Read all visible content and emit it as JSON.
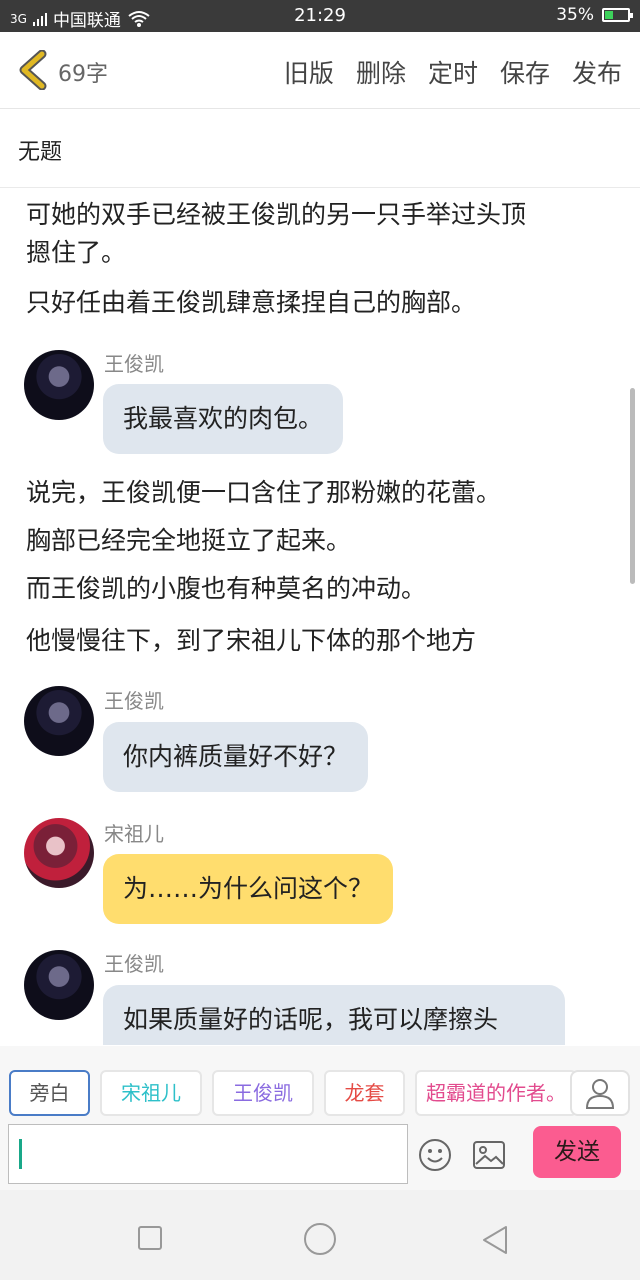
{
  "status_bar": {
    "signal": "3G",
    "carrier": "中国联通",
    "time": "21:29",
    "battery": "35%",
    "battery_level": 0.35
  },
  "header": {
    "char_count": "69字",
    "actions": [
      "旧版",
      "删除",
      "定时",
      "保存",
      "发布"
    ]
  },
  "title_field": {
    "value": "无题"
  },
  "story": [
    {
      "kind": "narration",
      "text": "可她的双手已经被王俊凯的另一只手举过头顶\n摁住了。"
    },
    {
      "kind": "narration",
      "text": "只好任由着王俊凯肆意揉捏自己的胸部。"
    },
    {
      "kind": "dialogue",
      "speaker": "王俊凯",
      "text": "我最喜欢的肉包。"
    },
    {
      "kind": "narration",
      "text": "说完，王俊凯便一口含住了那粉嫩的花蕾。"
    },
    {
      "kind": "narration",
      "text": "胸部已经完全地挺立了起来。"
    },
    {
      "kind": "narration",
      "text": "而王俊凯的小腹也有种莫名的冲动。"
    },
    {
      "kind": "narration",
      "text": "他慢慢往下，到了宋祖儿下体的那个地方"
    },
    {
      "kind": "dialogue",
      "speaker": "王俊凯",
      "text": "你内裤质量好不好？"
    },
    {
      "kind": "dialogue",
      "speaker": "宋祖儿",
      "text": "为……为什么问这个？"
    },
    {
      "kind": "dialogue",
      "speaker": "王俊凯",
      "text": "如果质量好的话呢，我可以摩擦头"
    }
  ],
  "role_chips": [
    "旁白",
    "宋祖儿",
    "王俊凯",
    "龙套",
    "超霸道的作者。"
  ],
  "input": {
    "value": "",
    "send_label": "发送"
  },
  "colors": {
    "bubble_gray": "#dfe6ee",
    "bubble_yellow": "#ffdd6e",
    "send": "#fb5c90",
    "back_arrow": "#e0b823"
  }
}
